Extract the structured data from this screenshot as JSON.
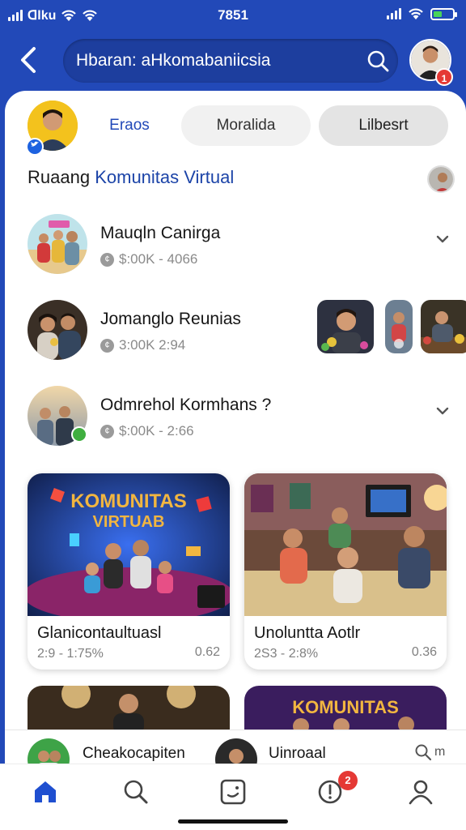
{
  "status_bar": {
    "carrier": "ᗡlku",
    "time": "7851"
  },
  "header": {
    "back_label": "‹",
    "search_text": "Hbaran: aHkomabaniicsia",
    "notification_count": "1"
  },
  "tabs": [
    {
      "label": "Eraos",
      "active": true
    },
    {
      "label": "Moralida",
      "active": false
    },
    {
      "label": "Lilbesrt",
      "active": false
    }
  ],
  "section": {
    "title_part1": "Ruaang",
    "title_part2": "Komunitas Virtual"
  },
  "list": [
    {
      "title": "Mauqln Canirga",
      "meta": "$:00K - 4066",
      "expand_icon": "chevron-down"
    },
    {
      "title": "Jomanglo Reunias",
      "meta": "3:00K   2:94"
    },
    {
      "title": "Odmrehol Kormhans ?",
      "meta": "$:00K - 2:66",
      "expand_icon": "chevron-down"
    }
  ],
  "cards": [
    {
      "title": "Glanicontaultuasl",
      "meta": "2:9 - 1:75%",
      "count": "0.62",
      "image_text": [
        "KOMUNITAS",
        "VIRTUAB"
      ]
    },
    {
      "title": "Unoluntta Aotlr",
      "meta": "2S3 - 2:8%",
      "count": "0.36"
    }
  ],
  "partial_cards": [
    {
      "image_text": ""
    },
    {
      "image_text": "KOMUNITAS"
    }
  ],
  "strip": [
    {
      "text": "Cheakocapiten"
    },
    {
      "text": "Uinroaal"
    }
  ],
  "strip_search_label": "m",
  "nav": [
    {
      "icon": "home-icon",
      "active": true
    },
    {
      "icon": "search-icon",
      "active": false
    },
    {
      "icon": "media-icon",
      "active": false
    },
    {
      "icon": "alerts-icon",
      "active": false,
      "badge": "2"
    },
    {
      "icon": "profile-icon",
      "active": false
    }
  ],
  "colors": {
    "brand_blue": "#2249b8",
    "badge_red": "#e53935",
    "online_green": "#3fae3f",
    "text_dark": "#161616",
    "text_muted": "#8a8a8a"
  }
}
